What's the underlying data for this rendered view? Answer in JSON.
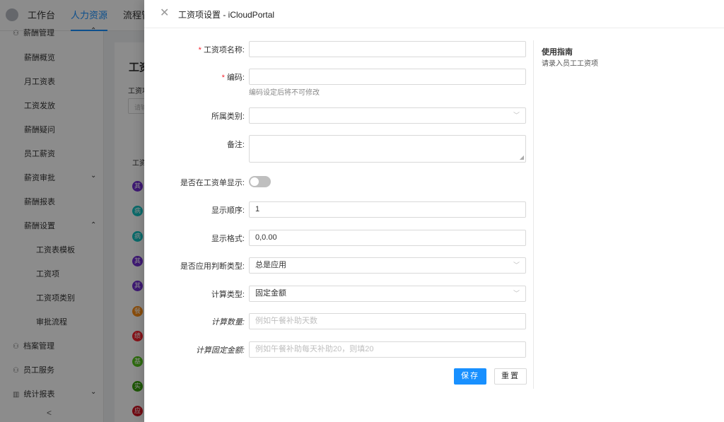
{
  "background": {
    "nav": [
      "工作台",
      "人力资源",
      "流程管"
    ],
    "active_nav": "人力资源",
    "sidebar": {
      "group_top": "薪酬管理",
      "items": [
        "薪酬概览",
        "月工资表",
        "工资发放",
        "薪酬疑问",
        "员工薪资",
        "薪资审批",
        "薪酬报表",
        "薪酬设置"
      ],
      "sub_items": [
        "工资表模板",
        "工资项",
        "工资项类别",
        "审批流程"
      ],
      "groups": [
        "档案管理",
        "员工服务",
        "统计报表"
      ],
      "collapse_glyph": "<"
    },
    "content_title": "工资",
    "content_label": "工资项",
    "content_input_placeholder": "请输",
    "table_header": "工资",
    "avatars": [
      {
        "text": "其",
        "color": "#722ed1"
      },
      {
        "text": "病",
        "color": "#13c2c2"
      },
      {
        "text": "病",
        "color": "#13c2c2"
      },
      {
        "text": "其",
        "color": "#722ed1"
      },
      {
        "text": "其",
        "color": "#722ed1"
      },
      {
        "text": "餐",
        "color": "#fa8c16"
      },
      {
        "text": "绩",
        "color": "#f5222d"
      },
      {
        "text": "基",
        "color": "#52c41a"
      },
      {
        "text": "实",
        "color": "#389e0d"
      },
      {
        "text": "应",
        "color": "#cf1322"
      }
    ]
  },
  "drawer": {
    "title": "工资项设置 - iCloudPortal",
    "fields": {
      "name": {
        "label": "工资项名称:",
        "required": "*",
        "value": ""
      },
      "code": {
        "label": "编码:",
        "required": "*",
        "value": "",
        "help": "编码设定后将不可修改"
      },
      "category": {
        "label": "所属类别:",
        "value": ""
      },
      "remark": {
        "label": "备注:",
        "value": ""
      },
      "show_on_slip": {
        "label": "是否在工资单显示:",
        "checked": false
      },
      "display_order": {
        "label": "显示顺序:",
        "value": "1"
      },
      "display_format": {
        "label": "显示格式:",
        "value": "0,0.00"
      },
      "apply_rule": {
        "label": "是否应用判断类型:",
        "value": "总是应用"
      },
      "calc_type": {
        "label": "计算类型:",
        "value": "固定金额"
      },
      "calc_quantity": {
        "label": "计算数量:",
        "placeholder": "例如午餐补助天数"
      },
      "calc_fixed_amount": {
        "label": "计算固定金额:",
        "placeholder": "例如午餐补助每天补助20，则填20"
      }
    },
    "buttons": {
      "save": "保存",
      "reset": "重置"
    },
    "guide": {
      "title": "使用指南",
      "text": "请录入员工工资项"
    }
  }
}
